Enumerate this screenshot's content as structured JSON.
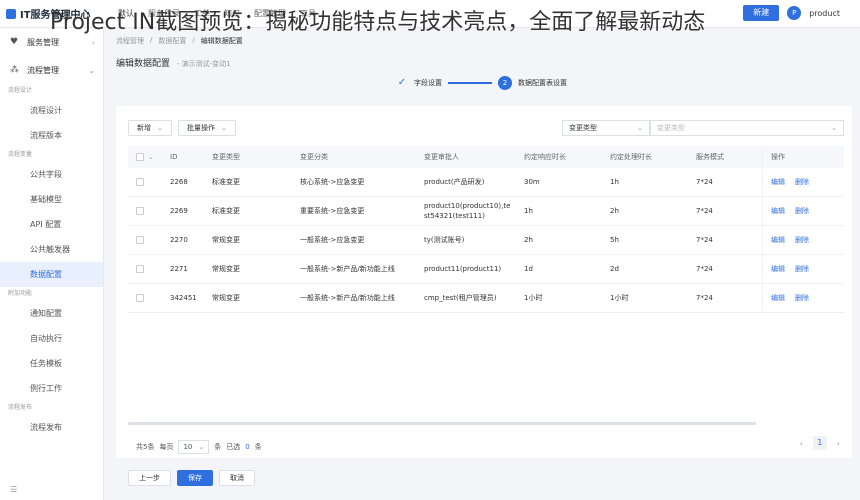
{
  "app": {
    "title": "IT服务管理中心"
  },
  "watermark": "Project IN截图预览：揭秘功能特点与技术亮点，全面了解最新动态",
  "top_menu": [
    "默认",
    "服务目录",
    "工单",
    "知识",
    "配置管理",
    "工具"
  ],
  "top_right": {
    "button_label": "新建",
    "avatar_text": "P",
    "user": "product"
  },
  "sidebar": {
    "groups": [
      {
        "label": "服务管理",
        "icon": "heart-icon"
      },
      {
        "label": "流程管理",
        "icon": "flow-icon"
      }
    ],
    "sections": [
      {
        "title": "流程设计",
        "items": [
          "流程设计",
          "流程版本"
        ]
      },
      {
        "title": "流程变量",
        "items": [
          "公共字段",
          "基础模型",
          "API 配置",
          "公共触发器",
          "数据配置"
        ]
      },
      {
        "title": "附加功能",
        "items": [
          "通知配置",
          "自动执行",
          "任务模板",
          "例行工作"
        ]
      },
      {
        "title": "流程发布",
        "items": [
          "流程发布"
        ]
      }
    ],
    "active_item": "数据配置",
    "footer_icon": "menu-icon"
  },
  "breadcrumb": [
    "流程管理",
    "数据配置",
    "编辑数据配置"
  ],
  "page": {
    "title": "编辑数据配置",
    "subtitle": "- 演示测试-变动1"
  },
  "steps": [
    {
      "label": "字段设置",
      "state": "done"
    },
    {
      "label": "数据配置表设置",
      "state": "active",
      "number": "2"
    }
  ],
  "toolbar": {
    "add_label": "新增",
    "batch_label": "批量操作"
  },
  "filter": {
    "type_value": "变更类型",
    "placeholder": "变更类型"
  },
  "table": {
    "headers": [
      "ID",
      "变更类型",
      "变更分类",
      "变更审批人",
      "约定响应时长",
      "约定处理时长",
      "服务模式",
      "操作"
    ],
    "rows": [
      {
        "id": "2268",
        "type": "标准变更",
        "category": "核心系统->应急变更",
        "approver": "product(产品研发)",
        "resp": "30m",
        "proc": "1h",
        "mode": "7*24"
      },
      {
        "id": "2269",
        "type": "标准变更",
        "category": "重要系统->应急变更",
        "approver": "product10(product10),test54321(test111)",
        "resp": "1h",
        "proc": "2h",
        "mode": "7*24"
      },
      {
        "id": "2270",
        "type": "常规变更",
        "category": "一般系统->应急变更",
        "approver": "ty(测试账号)",
        "resp": "2h",
        "proc": "5h",
        "mode": "7*24"
      },
      {
        "id": "2271",
        "type": "常规变更",
        "category": "一般系统->新产品/新功能上线",
        "approver": "product11(product11)",
        "resp": "1d",
        "proc": "2d",
        "mode": "7*24"
      },
      {
        "id": "342451",
        "type": "常规变更",
        "category": "一般系统->新产品/新功能上线",
        "approver": "cmp_test(租户管理员)",
        "resp": "1小时",
        "proc": "1小时",
        "mode": "7*24"
      }
    ],
    "op_edit": "编辑",
    "op_delete": "删除"
  },
  "pager": {
    "total": "共5条",
    "per_page_label": "每页",
    "per_page": "10",
    "unit": "条",
    "selected_label": "已选",
    "selected": "0",
    "selected_unit": "条",
    "current_page": "1"
  },
  "footer": {
    "prev": "上一步",
    "save": "保存",
    "cancel": "取消"
  }
}
